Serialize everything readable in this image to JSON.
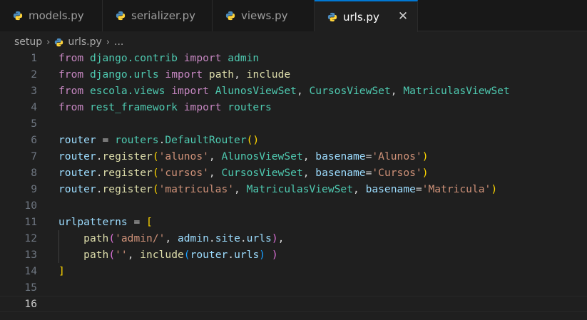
{
  "tabs": [
    {
      "label": "models.py",
      "icon": "python-icon",
      "active": false
    },
    {
      "label": "serializer.py",
      "icon": "python-icon",
      "active": false
    },
    {
      "label": "views.py",
      "icon": "python-icon",
      "active": false
    },
    {
      "label": "urls.py",
      "icon": "python-icon",
      "active": true
    }
  ],
  "close_glyph": "✕",
  "breadcrumb": {
    "folder": "setup",
    "file": "urls.py",
    "more": "...",
    "separator": "›"
  },
  "editor": {
    "current_line": 16,
    "line_numbers": [
      "1",
      "2",
      "3",
      "4",
      "5",
      "6",
      "7",
      "8",
      "9",
      "10",
      "11",
      "12",
      "13",
      "14",
      "15",
      "16"
    ],
    "lines": [
      [
        [
          "kw",
          "from"
        ],
        [
          "op",
          " "
        ],
        [
          "mod",
          "django.contrib"
        ],
        [
          "op",
          " "
        ],
        [
          "kw",
          "import"
        ],
        [
          "op",
          " "
        ],
        [
          "mod",
          "admin"
        ]
      ],
      [
        [
          "kw",
          "from"
        ],
        [
          "op",
          " "
        ],
        [
          "mod",
          "django.urls"
        ],
        [
          "op",
          " "
        ],
        [
          "kw",
          "import"
        ],
        [
          "op",
          " "
        ],
        [
          "fn",
          "path"
        ],
        [
          "op",
          ", "
        ],
        [
          "fn",
          "include"
        ]
      ],
      [
        [
          "kw",
          "from"
        ],
        [
          "op",
          " "
        ],
        [
          "mod",
          "escola.views"
        ],
        [
          "op",
          " "
        ],
        [
          "kw",
          "import"
        ],
        [
          "op",
          " "
        ],
        [
          "mod",
          "AlunosViewSet"
        ],
        [
          "op",
          ", "
        ],
        [
          "mod",
          "CursosViewSet"
        ],
        [
          "op",
          ", "
        ],
        [
          "mod",
          "MatriculasViewSet"
        ]
      ],
      [
        [
          "kw",
          "from"
        ],
        [
          "op",
          " "
        ],
        [
          "mod",
          "rest_framework"
        ],
        [
          "op",
          " "
        ],
        [
          "kw",
          "import"
        ],
        [
          "op",
          " "
        ],
        [
          "mod",
          "routers"
        ]
      ],
      [],
      [
        [
          "var",
          "router"
        ],
        [
          "op",
          " = "
        ],
        [
          "mod",
          "routers"
        ],
        [
          "op",
          "."
        ],
        [
          "mod",
          "DefaultRouter"
        ],
        [
          "br1",
          "()"
        ]
      ],
      [
        [
          "var",
          "router"
        ],
        [
          "op",
          "."
        ],
        [
          "fn",
          "register"
        ],
        [
          "br1",
          "("
        ],
        [
          "str",
          "'alunos'"
        ],
        [
          "op",
          ", "
        ],
        [
          "mod",
          "AlunosViewSet"
        ],
        [
          "op",
          ", "
        ],
        [
          "var",
          "basename"
        ],
        [
          "op",
          "="
        ],
        [
          "str",
          "'Alunos'"
        ],
        [
          "br1",
          ")"
        ]
      ],
      [
        [
          "var",
          "router"
        ],
        [
          "op",
          "."
        ],
        [
          "fn",
          "register"
        ],
        [
          "br1",
          "("
        ],
        [
          "str",
          "'cursos'"
        ],
        [
          "op",
          ", "
        ],
        [
          "mod",
          "CursosViewSet"
        ],
        [
          "op",
          ", "
        ],
        [
          "var",
          "basename"
        ],
        [
          "op",
          "="
        ],
        [
          "str",
          "'Cursos'"
        ],
        [
          "br1",
          ")"
        ]
      ],
      [
        [
          "var",
          "router"
        ],
        [
          "op",
          "."
        ],
        [
          "fn",
          "register"
        ],
        [
          "br1",
          "("
        ],
        [
          "str",
          "'matriculas'"
        ],
        [
          "op",
          ", "
        ],
        [
          "mod",
          "MatriculasViewSet"
        ],
        [
          "op",
          ", "
        ],
        [
          "var",
          "basename"
        ],
        [
          "op",
          "="
        ],
        [
          "str",
          "'Matricula'"
        ],
        [
          "br1",
          ")"
        ]
      ],
      [],
      [
        [
          "var",
          "urlpatterns"
        ],
        [
          "op",
          " = "
        ],
        [
          "br1",
          "["
        ]
      ],
      [
        [
          "op",
          "    "
        ],
        [
          "fn",
          "path"
        ],
        [
          "br2",
          "("
        ],
        [
          "str",
          "'admin/'"
        ],
        [
          "op",
          ", "
        ],
        [
          "var",
          "admin"
        ],
        [
          "op",
          "."
        ],
        [
          "var",
          "site"
        ],
        [
          "op",
          "."
        ],
        [
          "var",
          "urls"
        ],
        [
          "br2",
          ")"
        ],
        [
          "op",
          ","
        ]
      ],
      [
        [
          "op",
          "    "
        ],
        [
          "fn",
          "path"
        ],
        [
          "br2",
          "("
        ],
        [
          "str",
          "''"
        ],
        [
          "op",
          ", "
        ],
        [
          "fn",
          "include"
        ],
        [
          "br3",
          "("
        ],
        [
          "var",
          "router"
        ],
        [
          "op",
          "."
        ],
        [
          "var",
          "urls"
        ],
        [
          "br3",
          ")"
        ],
        [
          "op",
          " "
        ],
        [
          "br2",
          ")"
        ]
      ],
      [
        [
          "br1",
          "]"
        ]
      ],
      [],
      []
    ]
  },
  "colors": {
    "accent": "#0078d4",
    "python_blue": "#4b8bbe",
    "python_yellow": "#ffd43b"
  }
}
